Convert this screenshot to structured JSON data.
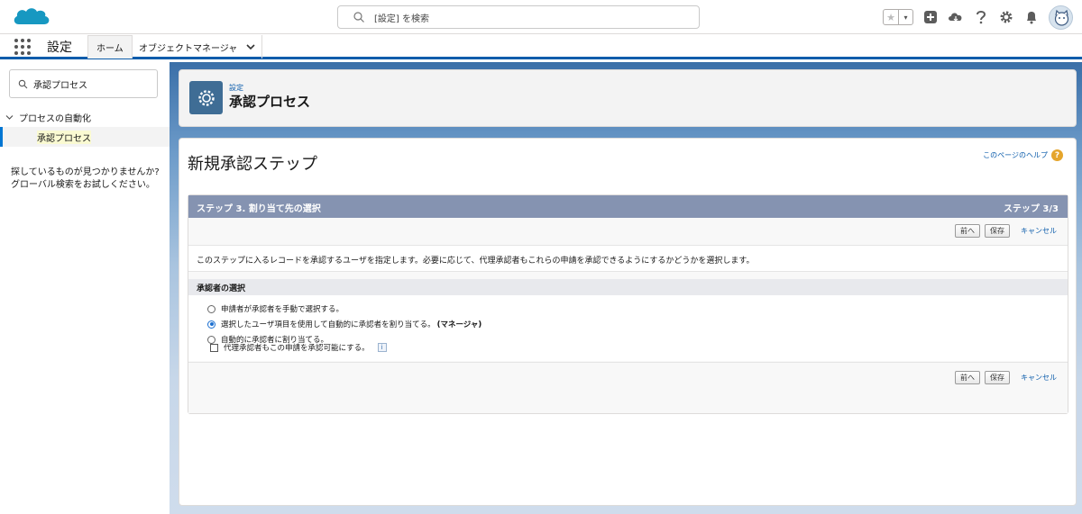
{
  "header": {
    "search_placeholder": "[設定] を検索",
    "favorites_star": "★",
    "favorites_caret": "▾"
  },
  "context_nav": {
    "app_name": "設定",
    "tabs": [
      {
        "label": "ホーム",
        "active": true
      },
      {
        "label": "オブジェクトマネージャ",
        "has_dropdown": true
      }
    ]
  },
  "sidebar": {
    "quick_find_value": "承認プロセス",
    "tree": {
      "parent_label": "プロセスの自動化",
      "child_label": "承認プロセス"
    },
    "not_found_line1": "探しているものが見つかりませんか?",
    "not_found_line2": "グローバル検索をお試しください。"
  },
  "page_header": {
    "breadcrumb": "設定",
    "title": "承認プロセス"
  },
  "content": {
    "title": "新規承認ステップ",
    "help_link": "このページのヘルプ",
    "help_icon_glyph": "?",
    "step_bar": {
      "left": "ステップ 3. 割り当て先の選択",
      "right": "ステップ 3/3"
    },
    "buttons": {
      "prev": "前へ",
      "save": "保存",
      "cancel": "キャンセル"
    },
    "description": "このステップに入るレコードを承認するユーザを指定します。必要に応じて、代理承認者もこれらの申請を承認できるようにするかどうかを選択します。",
    "section_title": "承認者の選択",
    "radio_options": [
      {
        "label": "申請者が承認者を手動で選択する。",
        "checked": false
      },
      {
        "label": "選択したユーザ項目を使用して自動的に承認者を割り当てる。",
        "suffix": "(マネージャ)",
        "checked": true
      },
      {
        "label": "自動的に承認者に割り当てる。",
        "checked": false
      }
    ],
    "delegate_checkbox_label": "代理承認者もこの申請を承認可能にする。",
    "delegate_checked": false,
    "info_glyph": "i"
  },
  "colors": {
    "brand_blue": "#0b5cab",
    "step_bar": "#8593b1",
    "header_icon_bg": "#3f6d95"
  }
}
